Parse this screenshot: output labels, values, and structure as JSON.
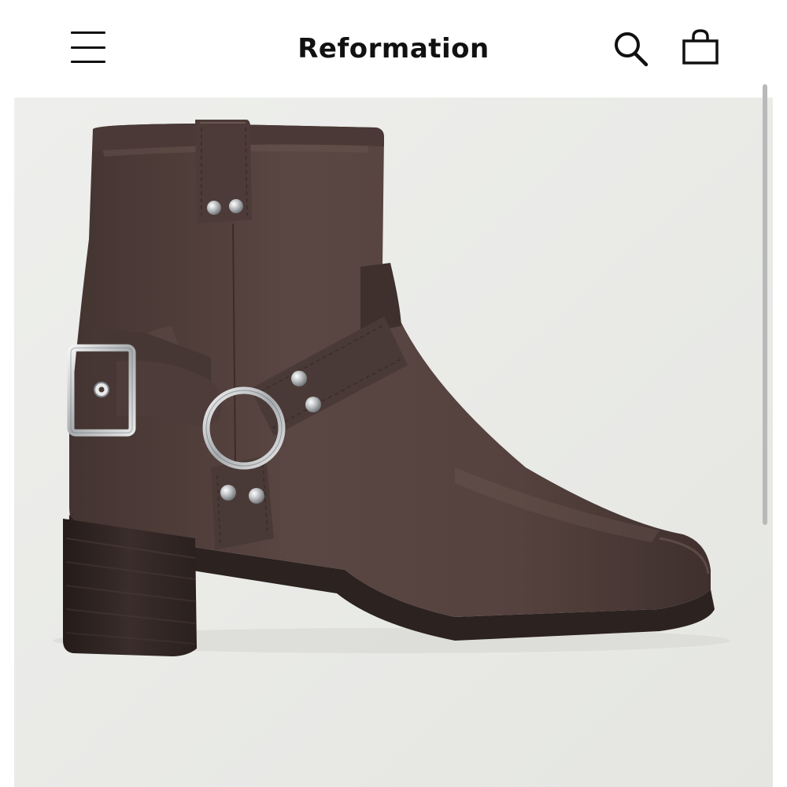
{
  "header": {
    "brand": "Reformation",
    "menu_icon": "hamburger-menu-icon",
    "search_icon": "search-icon",
    "bag_icon": "shopping-bag-icon"
  },
  "product": {
    "image": "brown-leather-harness-ankle-boot"
  },
  "colors": {
    "header_bg": "#ffffff",
    "text": "#111111",
    "image_bg": "#ecedea",
    "leather": "#4f3d39",
    "heel": "#2f2422",
    "hardware": "#c7c9cb"
  }
}
